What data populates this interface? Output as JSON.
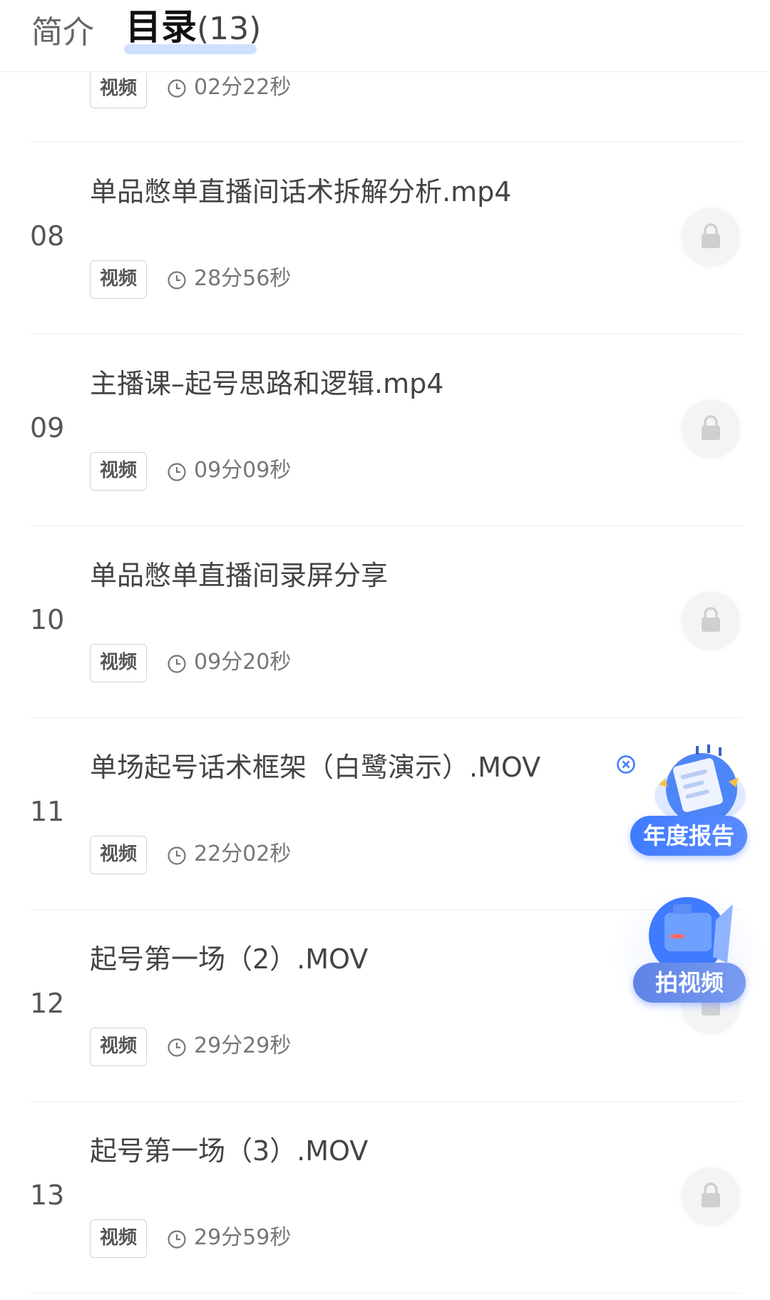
{
  "tabs": {
    "intro": "简介",
    "catalog": "目录",
    "catalog_count": "(13)"
  },
  "items": [
    {
      "index": "",
      "title": "",
      "type": "视频",
      "duration": "02分22秒",
      "locked": false
    },
    {
      "index": "08",
      "title": "单品憋单直播间话术拆解分析.mp4",
      "type": "视频",
      "duration": "28分56秒",
      "locked": true
    },
    {
      "index": "09",
      "title": "主播课–起号思路和逻辑.mp4",
      "type": "视频",
      "duration": "09分09秒",
      "locked": true
    },
    {
      "index": "10",
      "title": "单品憋单直播间录屏分享",
      "type": "视频",
      "duration": "09分20秒",
      "locked": true
    },
    {
      "index": "11",
      "title": "单场起号话术框架（白鹭演示）.MOV",
      "type": "视频",
      "duration": "22分02秒",
      "locked": true
    },
    {
      "index": "12",
      "title": "起号第一场（2）.MOV",
      "type": "视频",
      "duration": "29分29秒",
      "locked": true
    },
    {
      "index": "13",
      "title": "起号第一场（3）.MOV",
      "type": "视频",
      "duration": "29分59秒",
      "locked": true
    }
  ],
  "floating": {
    "annual_report": "年度报告",
    "shoot_video": "拍视频"
  },
  "icons": {
    "clock": "clock-icon",
    "lock": "lock-icon",
    "close": "close-icon",
    "report": "report-illustration-icon",
    "camera": "camera-illustration-icon"
  },
  "colors": {
    "accent": "#3f7bff",
    "tab_highlight": "#cfe0ff"
  }
}
